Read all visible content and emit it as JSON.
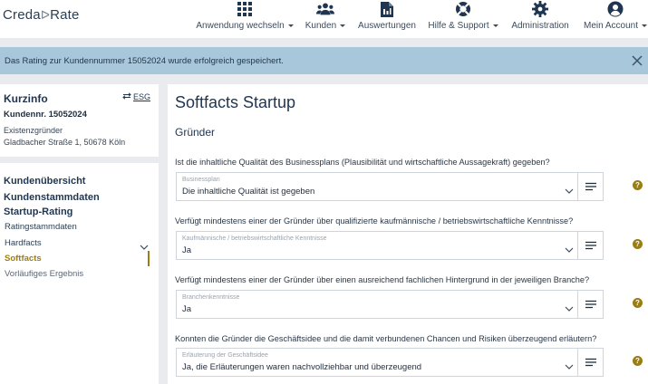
{
  "app": {
    "logo_left": "Creda",
    "logo_right": "Rate"
  },
  "nav": {
    "items": [
      {
        "label": "Anwendung wechseln",
        "icon": "grid-icon",
        "dropdown": true
      },
      {
        "label": "Kunden",
        "icon": "users-icon",
        "dropdown": true
      },
      {
        "label": "Auswertungen",
        "icon": "document-icon",
        "dropdown": false
      },
      {
        "label": "Hilfe & Support",
        "icon": "lifebuoy-icon",
        "dropdown": true
      },
      {
        "label": "Administration",
        "icon": "gear-icon",
        "dropdown": false
      },
      {
        "label": "Mein Account",
        "icon": "account-icon",
        "dropdown": true
      }
    ]
  },
  "banner": {
    "message": "Das Rating zur Kundennummer 15052024 wurde erfolgreich gespeichert."
  },
  "kurzinfo": {
    "title": "Kurzinfo",
    "esg_link": "ESG",
    "kunde": "Kundennr. 15052024",
    "type": "Existenzgründer",
    "address": "Gladbacher Straße 1, 50678 Köln"
  },
  "sidebar": {
    "kundenuebersicht": "Kundenübersicht",
    "kundenstammdaten": "Kundenstammdaten",
    "startup_rating": "Startup-Rating",
    "items": [
      {
        "label": "Ratingstammdaten"
      },
      {
        "label": "Hardfacts"
      },
      {
        "label": "Softfacts"
      },
      {
        "label": "Vorläufiges Ergebnis"
      }
    ]
  },
  "main": {
    "title": "Softfacts Startup",
    "section": "Gründer",
    "questions": [
      {
        "question": "Ist die inhaltliche Qualität des Businessplans (Plausibilität und wirtschaftliche Aussagekraft) gegeben?",
        "field_label": "Businessplan",
        "value": "Die inhaltliche Qualität ist gegeben"
      },
      {
        "question": "Verfügt mindestens einer der Gründer über qualifizierte kaufmännische / betriebswirtschaftliche Kenntnisse?",
        "field_label": "Kaufmännische / betriebswirtschaftliche Kenntnisse",
        "value": "Ja"
      },
      {
        "question": "Verfügt mindestens einer der Gründer über einen ausreichend fachlichen Hintergrund in der jeweiligen Branche?",
        "field_label": "Branchenkenntnisse",
        "value": "Ja"
      },
      {
        "question": "Konnten die Gründer die Geschäftsidee und die damit verbundenen Chancen und Risiken überzeugend erläutern?",
        "field_label": "Erläuterung der Geschäftsidee",
        "value": "Ja, die Erläuterungen waren nachvollziehbar und überzeugend"
      }
    ]
  },
  "colors": {
    "brand_dark": "#1f3550",
    "accent_gold": "#9a7d15",
    "banner_bg": "#a8c7da",
    "page_bg": "#e9ebee"
  }
}
